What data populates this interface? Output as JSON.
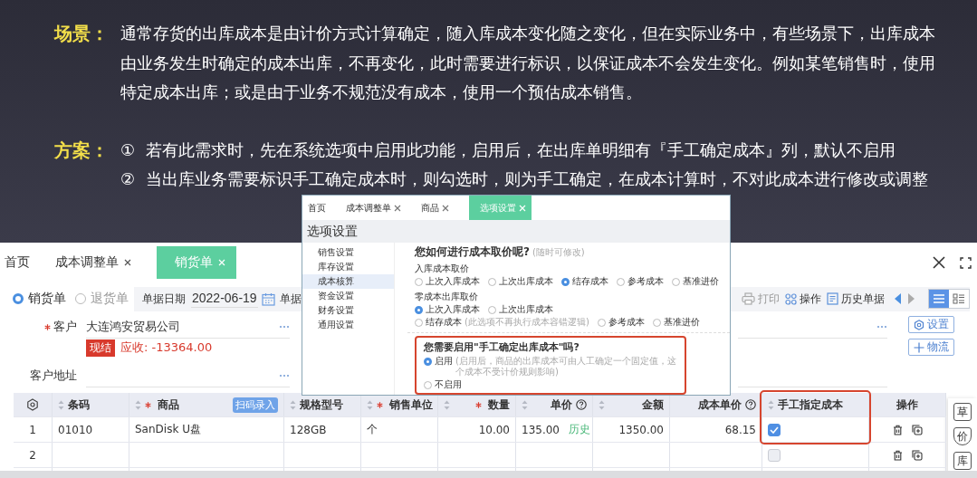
{
  "slide": {
    "scenario": {
      "label": "场景：",
      "lines": [
        "通常存货的出库成本是由计价方式计算确定，随入库成本变化随之变化，但在实际业务中，有些场景下，出库成本",
        "由业务发生时确定的成本出库，不再变化，此时需要进行标识，以保证成本不会发生变化。例如某笔销售时，使用",
        "特定成本出库；或是由于业务不规范没有成本，使用一个预估成本销售。"
      ]
    },
    "solution": {
      "label": "方案：",
      "items": [
        {
          "marker": "①",
          "text": "若有此需求时，先在系统选项中启用此功能，启用后，在出库单明细有『手工确定成本』列，默认不启用"
        },
        {
          "marker": "②",
          "text": "当出库业务需要标识手工确定成本时，则勾选时，则为手工确定，在成本计算时，不对此成本进行修改或调整"
        }
      ]
    }
  },
  "options_window": {
    "tabs": [
      {
        "label": "首页",
        "closable": false,
        "selected": false
      },
      {
        "label": "成本调整单",
        "closable": true,
        "selected": false
      },
      {
        "label": "商品",
        "closable": true,
        "selected": false
      },
      {
        "label": "选项设置",
        "closable": true,
        "selected": true
      }
    ],
    "title": "选项设置",
    "menu": [
      {
        "label": "销售设置",
        "selected": false
      },
      {
        "label": "库存设置",
        "selected": false
      },
      {
        "label": "成本核算",
        "selected": true
      },
      {
        "label": "资金设置",
        "selected": false
      },
      {
        "label": "财务设置",
        "selected": false
      },
      {
        "label": "通用设置",
        "selected": false
      }
    ],
    "question": "您如何进行成本取价呢?",
    "question_hint": "(随时可修改)",
    "groups": [
      {
        "label": "入库成本取价",
        "options": [
          {
            "label": "上次入库成本",
            "selected": false
          },
          {
            "label": "上次出库成本",
            "selected": false
          },
          {
            "label": "结存成本",
            "selected": true
          },
          {
            "label": "参考成本",
            "selected": false
          },
          {
            "label": "基准进价",
            "selected": false
          }
        ]
      },
      {
        "label": "零成本出库取价",
        "options": [
          {
            "label": "上次入库成本",
            "selected": true
          },
          {
            "label": "上次出库成本",
            "selected": false
          },
          {
            "label": "结存成本",
            "selected": false,
            "hint": "(此选项不再执行成本容错逻辑)"
          },
          {
            "label": "参考成本",
            "selected": false
          },
          {
            "label": "基准进价",
            "selected": false
          }
        ]
      }
    ],
    "manual_cost": {
      "highlighted": true,
      "question": "您需要启用\"手工确定出库成本\"吗?",
      "options": [
        {
          "label": "启用",
          "selected": true,
          "hint": "(启用后，商品的出库成本可由人工确定一个固定值，这个成本不受计价规则影响)"
        },
        {
          "label": "不启用",
          "selected": false
        }
      ]
    }
  },
  "sales_window": {
    "tabs": [
      {
        "label": "首页",
        "closable": false,
        "selected": false
      },
      {
        "label": "成本调整单",
        "closable": true,
        "selected": false
      },
      {
        "label": "销货单",
        "closable": true,
        "selected": true
      }
    ],
    "doc_types": [
      {
        "label": "销货单",
        "selected": true
      },
      {
        "label": "退货单",
        "selected": false
      }
    ],
    "date_field": {
      "label": "单据日期",
      "value": "2022-06-19"
    },
    "number_label": "单据",
    "toolbar": [
      {
        "kind": "print",
        "label": "打印",
        "disabled": true
      },
      {
        "kind": "ops",
        "label": "操作",
        "disabled": false
      },
      {
        "kind": "history",
        "label": "历史单据",
        "disabled": false
      }
    ],
    "nav": [
      {
        "kind": "prev",
        "disabled": false
      },
      {
        "kind": "next",
        "disabled": true
      }
    ],
    "views": [
      {
        "kind": "list",
        "selected": true
      },
      {
        "kind": "detail",
        "selected": false
      }
    ],
    "customer": {
      "label": "客户",
      "required": true,
      "value": "大连鸿安贸易公司"
    },
    "settlement_tag": "现结",
    "receivable": "应收: -13364.00",
    "address": {
      "label": "客户地址"
    },
    "side_buttons": [
      {
        "kind": "gear",
        "label": "设置"
      },
      {
        "kind": "plus",
        "label": "物流"
      }
    ],
    "table": {
      "columns": [
        {
          "kind": "settings"
        },
        {
          "label": "条码",
          "sortable": true,
          "required": false
        },
        {
          "label": "商品",
          "sortable": true,
          "required": true,
          "action": "扫码录入"
        },
        {
          "label": "规格型号",
          "sortable": true,
          "required": false
        },
        {
          "label": "销售单位",
          "sortable": true,
          "required": true
        },
        {
          "kind": "numeric",
          "label": "数量",
          "sortable": true,
          "required": true
        },
        {
          "kind": "numeric",
          "label": "单价",
          "sortable": true,
          "required": false,
          "help": true
        },
        {
          "kind": "numeric",
          "label": "金额",
          "sortable": true,
          "required": false
        },
        {
          "kind": "numeric",
          "label": "成本单价",
          "sortable": false,
          "required": false,
          "help": true
        },
        {
          "label": "手工指定成本",
          "sortable": true,
          "required": false,
          "highlighted": true
        },
        {
          "label": "操作",
          "sortable": false,
          "required": false
        }
      ],
      "rows": [
        {
          "index": "1",
          "cells": [
            "01010",
            "SanDisk U盘",
            "128GB",
            "个",
            "10.00",
            "135.00",
            "1350.00",
            "68.15"
          ],
          "price_link": "历史",
          "manual_cost": true
        },
        {
          "index": "2",
          "manual_cost": false
        }
      ]
    },
    "side_tools": [
      {
        "kind": "box",
        "label": "草"
      },
      {
        "kind": "shield",
        "label": "价"
      },
      {
        "kind": "box",
        "label": "库"
      }
    ]
  }
}
